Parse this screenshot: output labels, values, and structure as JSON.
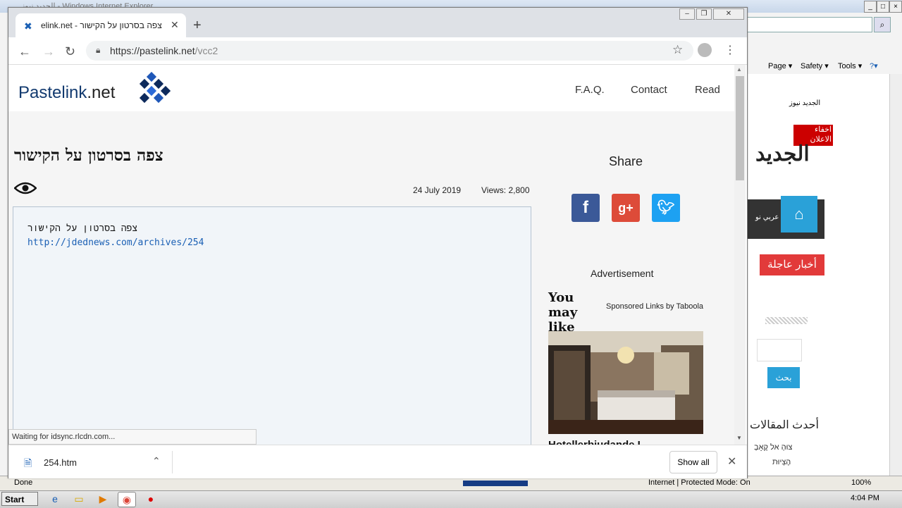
{
  "ie": {
    "title": "الجديد نيوز - Windows Internet Explorer",
    "commands": [
      "Page ▾",
      "Safety ▾",
      "Tools ▾",
      "?▾"
    ],
    "site_snippets": {
      "site_name": "الجديد نيوز",
      "hide_ads": "اخفاء الاعلان Hide Ads",
      "logo": "الجديد",
      "nav_text": "عربي نو",
      "breaking": "أخبار عاجلة",
      "search_btn": "بحث",
      "latest": "أحدث المقالات",
      "hebrew1": "צוּהָ אל קֶאָבָ",
      "hebrew2": "הֶצְיוּת"
    },
    "status_done": "Done",
    "status_zone": "Internet | Protected Mode: On",
    "zoom": "100%"
  },
  "taskbar": {
    "start": "Start",
    "time": "4:04 PM"
  },
  "chrome": {
    "tab_title": "elink.net - צפה בסרטון על הקישור",
    "url_scheme": "https://pastelink.net",
    "url_path": "/vcc2"
  },
  "site": {
    "logo_word": "Pastelink",
    "logo_tld": ".net",
    "nav": [
      "F.A.Q.",
      "Contact",
      "Read"
    ]
  },
  "paste": {
    "title": "צפה בסרטון על הקישור",
    "date": "24 July 2019",
    "views": "Views: 2,800",
    "line1": "צפה בסרטון על הקישור",
    "link": "http://jdednews.com/archives/254"
  },
  "sidebar": {
    "share": "Share",
    "advertisement": "Advertisement",
    "you_may_like": "You may like",
    "taboola": "Sponsored Links by Taboola",
    "ad_headline": "Hotellerbjudande I"
  },
  "status_bubble": "Waiting for idsync.rlcdn.com...",
  "download": {
    "file": "254.htm",
    "show_all": "Show all"
  },
  "colors": {
    "facebook": "#3b5998",
    "google": "#dd4b39",
    "twitter": "#1da1f2",
    "brand": "#1a4f93"
  }
}
